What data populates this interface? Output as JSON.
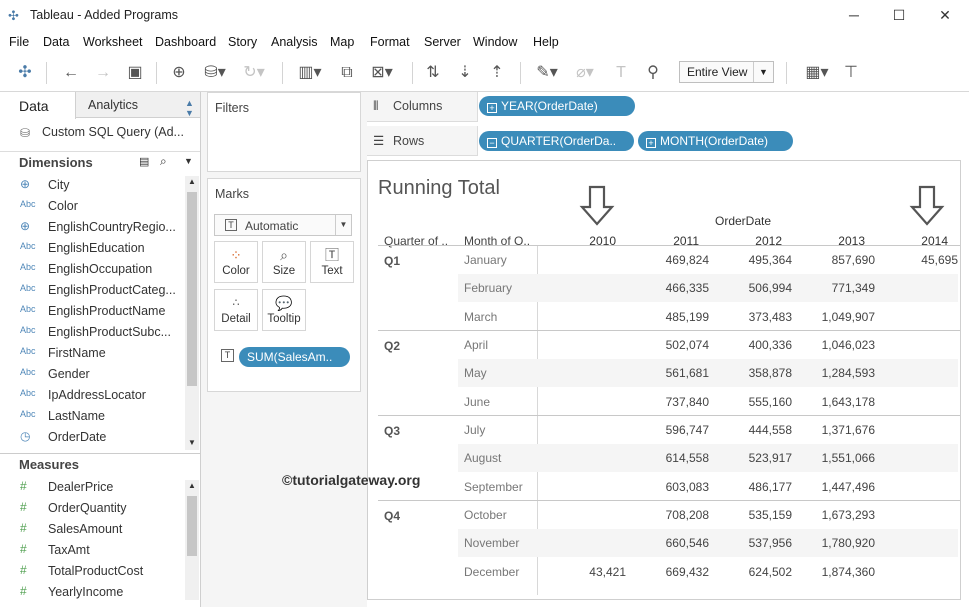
{
  "window": {
    "title": "Tableau - Added Programs"
  },
  "menu": [
    "File",
    "Data",
    "Worksheet",
    "Dashboard",
    "Story",
    "Analysis",
    "Map",
    "Format",
    "Server",
    "Window",
    "Help"
  ],
  "toolbar": {
    "fit_label": "Entire View"
  },
  "datapane": {
    "tab_data": "Data",
    "tab_analytics": "Analytics",
    "datasource": "Custom SQL Query (Ad...",
    "dimensions_label": "Dimensions",
    "dimensions": [
      {
        "icon": "globe-icon",
        "type": "",
        "name": "City"
      },
      {
        "icon": "abc-icon",
        "type": "Abc",
        "name": "Color"
      },
      {
        "icon": "globe-icon",
        "type": "",
        "name": "EnglishCountryRegio..."
      },
      {
        "icon": "abc-icon",
        "type": "Abc",
        "name": "EnglishEducation"
      },
      {
        "icon": "abc-icon",
        "type": "Abc",
        "name": "EnglishOccupation"
      },
      {
        "icon": "abc-icon",
        "type": "Abc",
        "name": "EnglishProductCateg..."
      },
      {
        "icon": "abc-icon",
        "type": "Abc",
        "name": "EnglishProductName"
      },
      {
        "icon": "abc-icon",
        "type": "Abc",
        "name": "EnglishProductSubc..."
      },
      {
        "icon": "abc-icon",
        "type": "Abc",
        "name": "FirstName"
      },
      {
        "icon": "abc-icon",
        "type": "Abc",
        "name": "Gender"
      },
      {
        "icon": "abc-icon",
        "type": "Abc",
        "name": "IpAddressLocator"
      },
      {
        "icon": "abc-icon",
        "type": "Abc",
        "name": "LastName"
      },
      {
        "icon": "date-icon",
        "type": "",
        "name": "OrderDate"
      }
    ],
    "measures_label": "Measures",
    "measures": [
      "DealerPrice",
      "OrderQuantity",
      "SalesAmount",
      "TaxAmt",
      "TotalProductCost",
      "YearlyIncome"
    ]
  },
  "cards": {
    "filters_label": "Filters",
    "marks_label": "Marks",
    "mark_type": "Automatic",
    "mark_buttons": [
      "Color",
      "Size",
      "Text",
      "Detail",
      "Tooltip"
    ],
    "marks_pill": "SUM(SalesAm.."
  },
  "shelves": {
    "columns_label": "Columns",
    "rows_label": "Rows",
    "columns_pill": "YEAR(OrderDate)",
    "rows_pills": [
      "QUARTER(OrderDa..",
      "MONTH(OrderDate)"
    ]
  },
  "view": {
    "title": "Running Total",
    "column_field": "OrderDate",
    "row_header_quarter": "Quarter of ..",
    "row_header_month": "Month of O..",
    "years": [
      "2010",
      "2011",
      "2012",
      "2013",
      "2014"
    ],
    "quarters": [
      {
        "label": "Q1",
        "months": [
          {
            "name": "January",
            "values": [
              "",
              "469,824",
              "495,364",
              "857,690",
              "45,695"
            ]
          },
          {
            "name": "February",
            "values": [
              "",
              "466,335",
              "506,994",
              "771,349",
              ""
            ]
          },
          {
            "name": "March",
            "values": [
              "",
              "485,199",
              "373,483",
              "1,049,907",
              ""
            ]
          }
        ]
      },
      {
        "label": "Q2",
        "months": [
          {
            "name": "April",
            "values": [
              "",
              "502,074",
              "400,336",
              "1,046,023",
              ""
            ]
          },
          {
            "name": "May",
            "values": [
              "",
              "561,681",
              "358,878",
              "1,284,593",
              ""
            ]
          },
          {
            "name": "June",
            "values": [
              "",
              "737,840",
              "555,160",
              "1,643,178",
              ""
            ]
          }
        ]
      },
      {
        "label": "Q3",
        "months": [
          {
            "name": "July",
            "values": [
              "",
              "596,747",
              "444,558",
              "1,371,676",
              ""
            ]
          },
          {
            "name": "August",
            "values": [
              "",
              "614,558",
              "523,917",
              "1,551,066",
              ""
            ]
          },
          {
            "name": "September",
            "values": [
              "",
              "603,083",
              "486,177",
              "1,447,496",
              ""
            ]
          }
        ]
      },
      {
        "label": "Q4",
        "months": [
          {
            "name": "October",
            "values": [
              "",
              "708,208",
              "535,159",
              "1,673,293",
              ""
            ]
          },
          {
            "name": "November",
            "values": [
              "",
              "660,546",
              "537,956",
              "1,780,920",
              ""
            ]
          },
          {
            "name": "December",
            "values": [
              "43,421",
              "669,432",
              "624,502",
              "1,874,360",
              ""
            ]
          }
        ]
      }
    ]
  },
  "watermark": "©tutorialgateway.org",
  "colors": {
    "pill": "#3b8cba",
    "arrow": "#555555"
  }
}
